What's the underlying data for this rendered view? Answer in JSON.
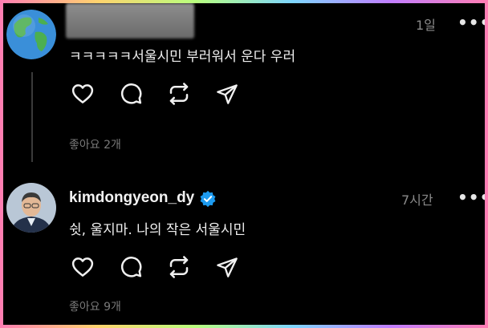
{
  "posts": [
    {
      "username": "",
      "time": "1일",
      "more": "•••",
      "text": "ㅋㅋㅋㅋㅋ서울시민 부러워서 운다 우러",
      "likes": "좋아요 2개",
      "avatar_icon": "globe-icon"
    },
    {
      "username": "kimdongyeon_dy",
      "verified": true,
      "time": "7시간",
      "more": "•••",
      "text": "쉿, 울지마. 나의 작은 서울시민",
      "likes": "좋아요 9개",
      "avatar_icon": "profile-photo"
    }
  ],
  "actions": [
    "heart-icon",
    "comment-icon",
    "repost-icon",
    "share-icon"
  ],
  "colors": {
    "background": "#000000",
    "text": "#f0f0f0",
    "muted": "#8a8a8a",
    "verified": "#1d9bf0"
  }
}
